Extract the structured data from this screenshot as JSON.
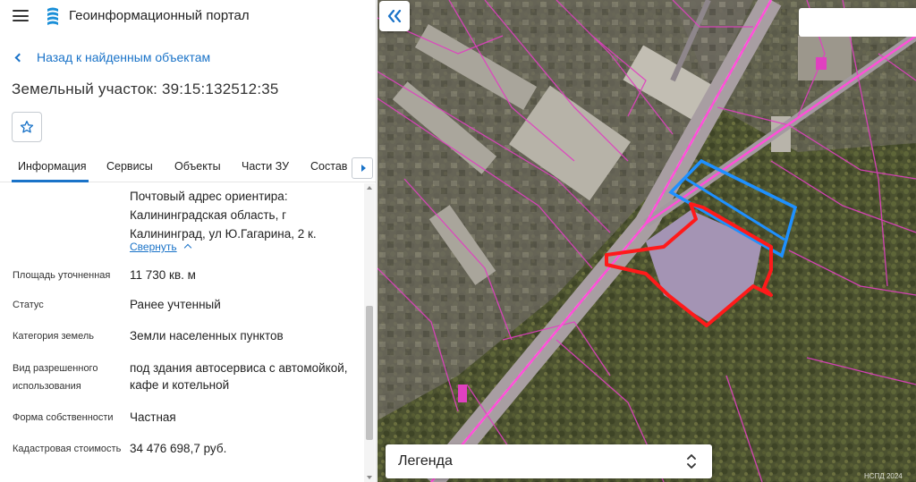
{
  "app": {
    "title": "Геоинформационный портал",
    "menu_icon": "hamburger-icon",
    "logo_icon": "portal-logo-icon"
  },
  "nav": {
    "back_label": "Назад к найденным объектам"
  },
  "object": {
    "title": "Земельный участок: 39:15:132512:35"
  },
  "tabs": [
    {
      "label": "Информация",
      "active": true
    },
    {
      "label": "Сервисы"
    },
    {
      "label": "Объекты"
    },
    {
      "label": "Части ЗУ"
    },
    {
      "label": "Состав"
    }
  ],
  "details": {
    "address_text": "Почтовый адрес ориентира: Калининградская область, г Калининград, ул Ю.Гагарина, 2 к.",
    "collapse_label": "Свернуть",
    "rows": [
      {
        "label": "Площадь уточненная",
        "value": "11 730 кв. м"
      },
      {
        "label": "Статус",
        "value": "Ранее учтенный"
      },
      {
        "label": "Категория земель",
        "value": "Земли населенных пунктов"
      },
      {
        "label": "Вид разрешенного использования",
        "value": "под здания автосервиса с автомойкой, кафе и котельной"
      },
      {
        "label": "Форма собственности",
        "value": "Частная"
      },
      {
        "label": "Кадастровая стоимость",
        "value": "34 476 698,7 руб."
      }
    ]
  },
  "map": {
    "legend_label": "Легенда",
    "copyright": "НСПД 2024",
    "colors": {
      "parcel_selected": "#ff1a1a",
      "parcel_neighbor": "#1e90ff",
      "cadastral_lines": "#e040c0",
      "road": "#b0a8b0"
    }
  }
}
